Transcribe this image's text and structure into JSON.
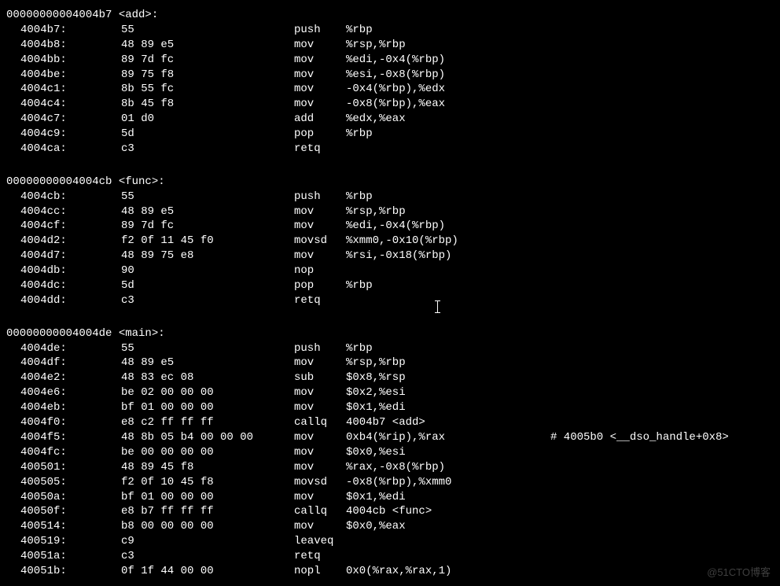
{
  "watermark": "@51CTO博客",
  "functions": [
    {
      "header": "00000000004004b7 <add>:",
      "lines": [
        {
          "addr": "4004b7:",
          "bytes": "55",
          "mn": "push",
          "ops": "%rbp",
          "comment": ""
        },
        {
          "addr": "4004b8:",
          "bytes": "48 89 e5",
          "mn": "mov",
          "ops": "%rsp,%rbp",
          "comment": ""
        },
        {
          "addr": "4004bb:",
          "bytes": "89 7d fc",
          "mn": "mov",
          "ops": "%edi,-0x4(%rbp)",
          "comment": ""
        },
        {
          "addr": "4004be:",
          "bytes": "89 75 f8",
          "mn": "mov",
          "ops": "%esi,-0x8(%rbp)",
          "comment": ""
        },
        {
          "addr": "4004c1:",
          "bytes": "8b 55 fc",
          "mn": "mov",
          "ops": "-0x4(%rbp),%edx",
          "comment": ""
        },
        {
          "addr": "4004c4:",
          "bytes": "8b 45 f8",
          "mn": "mov",
          "ops": "-0x8(%rbp),%eax",
          "comment": ""
        },
        {
          "addr": "4004c7:",
          "bytes": "01 d0",
          "mn": "add",
          "ops": "%edx,%eax",
          "comment": ""
        },
        {
          "addr": "4004c9:",
          "bytes": "5d",
          "mn": "pop",
          "ops": "%rbp",
          "comment": ""
        },
        {
          "addr": "4004ca:",
          "bytes": "c3",
          "mn": "retq",
          "ops": "",
          "comment": ""
        }
      ]
    },
    {
      "header": "00000000004004cb <func>:",
      "lines": [
        {
          "addr": "4004cb:",
          "bytes": "55",
          "mn": "push",
          "ops": "%rbp",
          "comment": ""
        },
        {
          "addr": "4004cc:",
          "bytes": "48 89 e5",
          "mn": "mov",
          "ops": "%rsp,%rbp",
          "comment": ""
        },
        {
          "addr": "4004cf:",
          "bytes": "89 7d fc",
          "mn": "mov",
          "ops": "%edi,-0x4(%rbp)",
          "comment": ""
        },
        {
          "addr": "4004d2:",
          "bytes": "f2 0f 11 45 f0",
          "mn": "movsd",
          "ops": "%xmm0,-0x10(%rbp)",
          "comment": ""
        },
        {
          "addr": "4004d7:",
          "bytes": "48 89 75 e8",
          "mn": "mov",
          "ops": "%rsi,-0x18(%rbp)",
          "comment": ""
        },
        {
          "addr": "4004db:",
          "bytes": "90",
          "mn": "nop",
          "ops": "",
          "comment": ""
        },
        {
          "addr": "4004dc:",
          "bytes": "5d",
          "mn": "pop",
          "ops": "%rbp",
          "comment": ""
        },
        {
          "addr": "4004dd:",
          "bytes": "c3",
          "mn": "retq",
          "ops": "",
          "comment": ""
        }
      ]
    },
    {
      "header": "00000000004004de <main>:",
      "lines": [
        {
          "addr": "4004de:",
          "bytes": "55",
          "mn": "push",
          "ops": "%rbp",
          "comment": ""
        },
        {
          "addr": "4004df:",
          "bytes": "48 89 e5",
          "mn": "mov",
          "ops": "%rsp,%rbp",
          "comment": ""
        },
        {
          "addr": "4004e2:",
          "bytes": "48 83 ec 08",
          "mn": "sub",
          "ops": "$0x8,%rsp",
          "comment": ""
        },
        {
          "addr": "4004e6:",
          "bytes": "be 02 00 00 00",
          "mn": "mov",
          "ops": "$0x2,%esi",
          "comment": ""
        },
        {
          "addr": "4004eb:",
          "bytes": "bf 01 00 00 00",
          "mn": "mov",
          "ops": "$0x1,%edi",
          "comment": ""
        },
        {
          "addr": "4004f0:",
          "bytes": "e8 c2 ff ff ff",
          "mn": "callq",
          "ops": "4004b7 <add>",
          "comment": ""
        },
        {
          "addr": "4004f5:",
          "bytes": "48 8b 05 b4 00 00 00",
          "mn": "mov",
          "ops": "0xb4(%rip),%rax",
          "comment": "# 4005b0 <__dso_handle+0x8>"
        },
        {
          "addr": "4004fc:",
          "bytes": "be 00 00 00 00",
          "mn": "mov",
          "ops": "$0x0,%esi",
          "comment": ""
        },
        {
          "addr": "400501:",
          "bytes": "48 89 45 f8",
          "mn": "mov",
          "ops": "%rax,-0x8(%rbp)",
          "comment": ""
        },
        {
          "addr": "400505:",
          "bytes": "f2 0f 10 45 f8",
          "mn": "movsd",
          "ops": "-0x8(%rbp),%xmm0",
          "comment": ""
        },
        {
          "addr": "40050a:",
          "bytes": "bf 01 00 00 00",
          "mn": "mov",
          "ops": "$0x1,%edi",
          "comment": ""
        },
        {
          "addr": "40050f:",
          "bytes": "e8 b7 ff ff ff",
          "mn": "callq",
          "ops": "4004cb <func>",
          "comment": ""
        },
        {
          "addr": "400514:",
          "bytes": "b8 00 00 00 00",
          "mn": "mov",
          "ops": "$0x0,%eax",
          "comment": ""
        },
        {
          "addr": "400519:",
          "bytes": "c9",
          "mn": "leaveq",
          "ops": "",
          "comment": ""
        },
        {
          "addr": "40051a:",
          "bytes": "c3",
          "mn": "retq",
          "ops": "",
          "comment": ""
        },
        {
          "addr": "40051b:",
          "bytes": "0f 1f 44 00 00",
          "mn": "nopl",
          "ops": "0x0(%rax,%rax,1)",
          "comment": ""
        }
      ]
    }
  ]
}
